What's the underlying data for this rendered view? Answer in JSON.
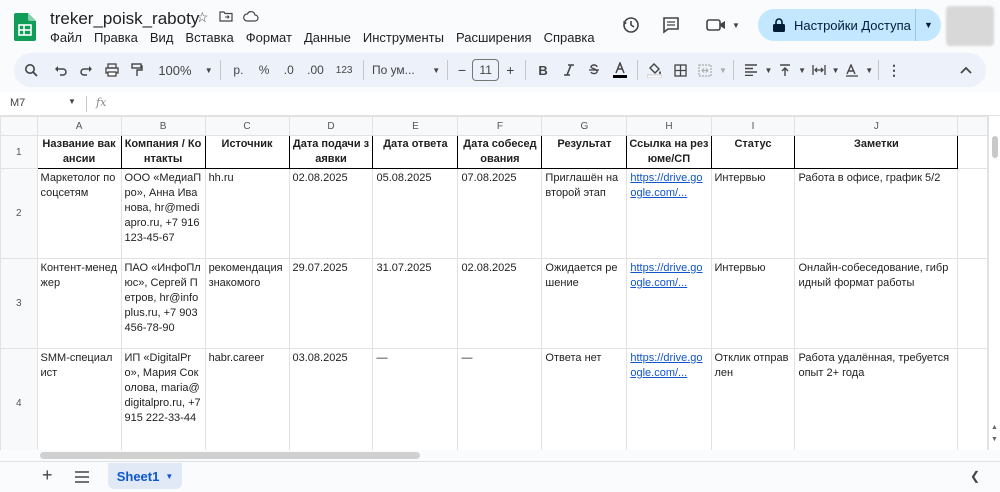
{
  "app": {
    "doc_title": "treker_poisk_raboty",
    "menu": [
      "Файл",
      "Правка",
      "Вид",
      "Вставка",
      "Формат",
      "Данные",
      "Инструменты",
      "Расширения",
      "Справка"
    ],
    "share_label": "Настройки Доступа",
    "colors": {
      "accent": "#0b57d0",
      "share_bg": "#c2e7ff",
      "link": "#1155cc",
      "logo": "#0f9d58"
    }
  },
  "toolbar": {
    "zoom": "100%",
    "currency": "р.",
    "percent": "%",
    "dec_decrease": ".0",
    "dec_increase": ".00",
    "number_format": "123",
    "font": "По ум...",
    "font_size": "11",
    "minus": "−",
    "plus": "+",
    "bold": "B"
  },
  "formula_bar": {
    "cell_ref": "M7",
    "fx": "fx",
    "value": ""
  },
  "grid": {
    "columns": [
      "A",
      "B",
      "C",
      "D",
      "E",
      "F",
      "G",
      "H",
      "I",
      "J"
    ],
    "rows": [
      {
        "num": "1",
        "cells": [
          "Название вакансии",
          "Компания / Контакты",
          "Источник",
          "Дата подачи заявки",
          "Дата ответа",
          "Дата собеседования",
          "Результат",
          "Ссылка на резюме/СП",
          "Статус",
          "Заметки"
        ]
      },
      {
        "num": "2",
        "cells": [
          "Маркетолог по соцсетям",
          "ООО «МедиаПро», Анна Иванова, hr@mediapro.ru, +7 916 123-45-67",
          "hh.ru",
          "02.08.2025",
          "05.08.2025",
          "07.08.2025",
          "Приглашён на второй этап",
          "https://drive.google.com/...",
          "Интервью",
          "Работа в офисе, график 5/2"
        ]
      },
      {
        "num": "3",
        "cells": [
          "Контент-менеджер",
          "ПАО «ИнфоПлюс», Сергей Петров, hr@infoplus.ru, +7 903 456-78-90",
          "рекомендация знакомого",
          "29.07.2025",
          "31.07.2025",
          "02.08.2025",
          "Ожидается решение",
          "https://drive.google.com/...",
          "Интервью",
          "Онлайн-собеседование, гибридный формат работы"
        ]
      },
      {
        "num": "4",
        "cells": [
          "SMM-специалист",
          "ИП «DigitalPro», Мария Соколова, maria@digitalpro.ru, +7 915 222-33-44",
          "habr.career",
          "03.08.2025",
          "—",
          "—",
          "Ответа нет",
          "https://drive.google.com/...",
          "Отклик отправлен",
          "Работа удалённая, требуется опыт 2+ года"
        ]
      }
    ]
  },
  "sheets": {
    "tabs": [
      "Sheet1"
    ],
    "add": "+"
  }
}
